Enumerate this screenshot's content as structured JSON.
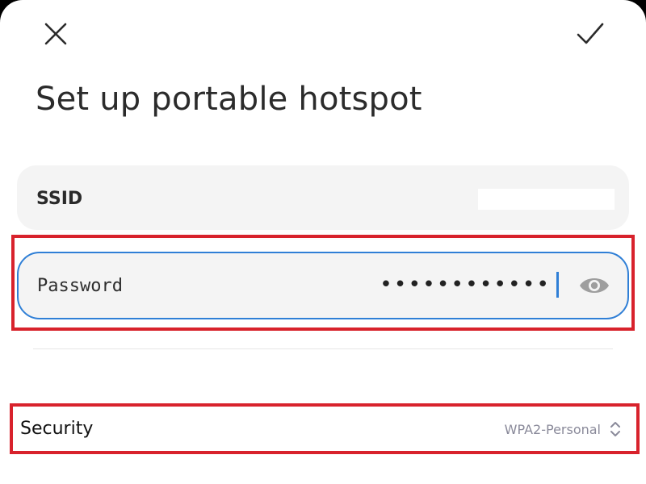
{
  "header": {
    "close_icon": "close-icon",
    "confirm_icon": "check-icon",
    "title": "Set up portable hotspot"
  },
  "ssid": {
    "label": "SSID",
    "value": ""
  },
  "password": {
    "label": "Password",
    "masked_value": "••••••••••••",
    "visibility_icon": "eye-icon",
    "focus_color": "#2f7fd6"
  },
  "security": {
    "label": "Security",
    "value": "WPA2-Personal",
    "selector_icon": "chevron-up-down-icon"
  },
  "colors": {
    "highlight": "#d8222c",
    "card_background": "#f4f4f4"
  }
}
